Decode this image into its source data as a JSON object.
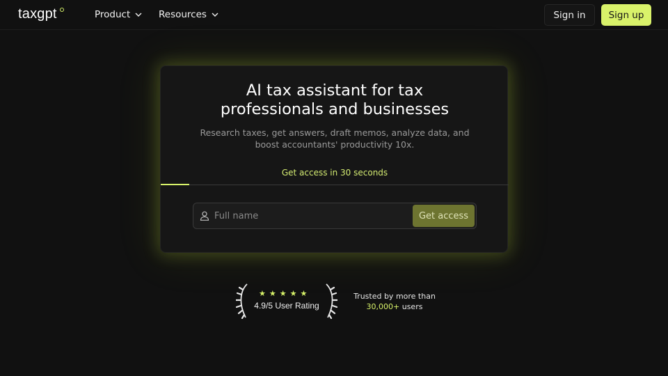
{
  "brand": {
    "name": "taxgpt",
    "accent": "#d8f36a"
  },
  "nav": {
    "items": [
      {
        "label": "Product",
        "icon": "chevron-down-icon"
      },
      {
        "label": "Resources",
        "icon": "chevron-down-icon"
      }
    ],
    "signin_label": "Sign in",
    "signup_label": "Sign up"
  },
  "hero": {
    "headline_line1": "AI tax assistant for tax",
    "headline_line2": "professionals and businesses",
    "sub_line1": "Research taxes, get answers, draft memos, analyze data, and",
    "sub_line2": "boost accountants' productivity 10x.",
    "tab_label": "Get access in 30 seconds",
    "input_placeholder": "Full name",
    "input_value": "",
    "cta_label": "Get access"
  },
  "rating": {
    "stars": 5,
    "text": "4.9/5 User Rating",
    "trust_line1": "Trusted by more than",
    "trust_count": "30,000+",
    "trust_suffix": " users"
  }
}
